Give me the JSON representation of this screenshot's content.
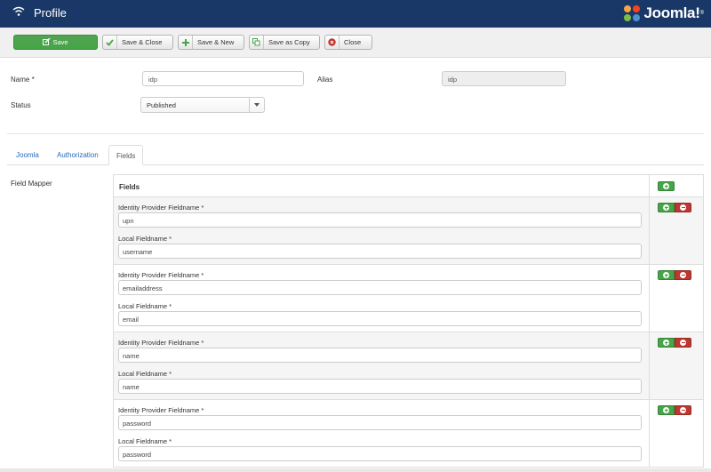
{
  "header": {
    "title": "Profile",
    "logo_text": "Joomla!",
    "logo_reg": "®"
  },
  "toolbar": {
    "save": "Save",
    "save_close": "Save & Close",
    "save_new": "Save & New",
    "save_copy": "Save as Copy",
    "close": "Close"
  },
  "form": {
    "name_label": "Name *",
    "name_value": "idp",
    "alias_label": "Alias",
    "alias_value": "idp",
    "status_label": "Status",
    "status_value": "Published"
  },
  "tabs": [
    "Joomla",
    "Authorization",
    "Fields"
  ],
  "active_tab": "Fields",
  "field_mapper": {
    "label": "Field Mapper",
    "header": "Fields",
    "idp_label": "Identity Provider Fieldname *",
    "local_label": "Local Fieldname *",
    "rows": [
      {
        "idp": "upn",
        "local": "username"
      },
      {
        "idp": "emailaddress",
        "local": "email"
      },
      {
        "idp": "name",
        "local": "name"
      },
      {
        "idp": "password",
        "local": "password"
      }
    ]
  },
  "colors": {
    "header_bg": "#1a3867",
    "save_green": "#46a546",
    "remove_red": "#bd362f",
    "link_blue": "#2a69b8"
  }
}
